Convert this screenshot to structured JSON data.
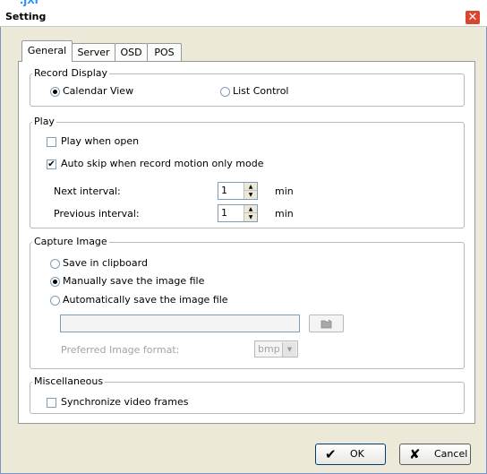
{
  "window": {
    "title": "Setting",
    "close_glyph": "✕",
    "top_fragment": ".jxl"
  },
  "tabs": [
    {
      "label": "General",
      "active": true
    },
    {
      "label": "Server",
      "active": false
    },
    {
      "label": "OSD",
      "active": false
    },
    {
      "label": "POS",
      "active": false
    }
  ],
  "record_display": {
    "legend": "Record Display",
    "options": [
      {
        "label": "Calendar View",
        "selected": true
      },
      {
        "label": "List Control",
        "selected": false
      }
    ]
  },
  "play": {
    "legend": "Play",
    "play_when_open": {
      "label": "Play when open",
      "checked": false
    },
    "auto_skip": {
      "label": "Auto skip when record motion only mode",
      "checked": true,
      "mark": "✔"
    },
    "next_interval": {
      "label": "Next interval:",
      "value": "1",
      "unit": "min"
    },
    "previous_interval": {
      "label": "Previous interval:",
      "value": "1",
      "unit": "min"
    }
  },
  "capture_image": {
    "legend": "Capture Image",
    "options": [
      {
        "label": "Save in clipboard",
        "selected": false
      },
      {
        "label": "Manually save the image file",
        "selected": true
      },
      {
        "label": "Automatically save the image file",
        "selected": false
      }
    ],
    "path_value": "",
    "browse_icon": "folder-open-icon",
    "format_label": "Preferred Image format:",
    "format_value": "bmp"
  },
  "misc": {
    "legend": "Miscellaneous",
    "sync": {
      "label": "Synchronize video frames",
      "checked": false
    }
  },
  "buttons": {
    "ok": {
      "label": "OK",
      "icon": "✔"
    },
    "cancel": {
      "label": "Cancel",
      "icon": "✘"
    }
  }
}
